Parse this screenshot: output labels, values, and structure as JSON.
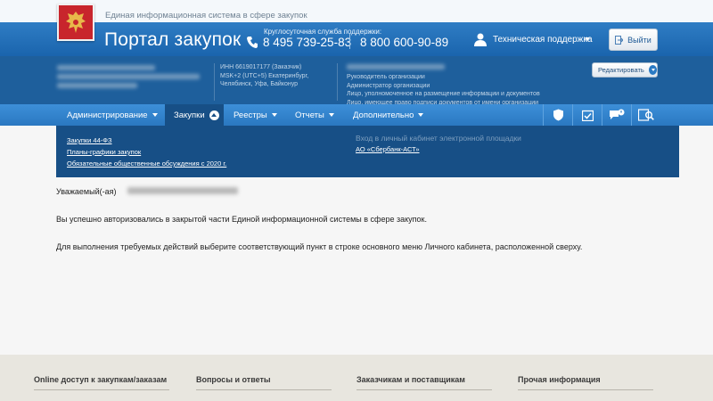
{
  "header": {
    "system_title": "Единая информационная система в сфере закупок",
    "portal_title": "Портал закупок",
    "support_caption": "Круглосуточная служба поддержки:",
    "phone_1": "8 495 739-25-83",
    "phone_2": "8 800 600-90-89",
    "tech_support": "Техническая поддержка",
    "exit_label": "Выйти"
  },
  "org": {
    "inn_line": "ИНН 6619017177 (Заказчик)",
    "tz_line1": "MSK+2 (UTC+5) Екатеринбург,",
    "tz_line2": "Челябинск, Уфа, Байконур",
    "roles": [
      "Руководитель организации",
      "Администратор организации",
      "Лицо, уполномоченное на размещение информации и документов",
      "Лицо, имеющее право подписи документов от имени организации"
    ],
    "edit_label": "Редактировать"
  },
  "nav": {
    "items": [
      {
        "label": "Администрирование"
      },
      {
        "label": "Закупки"
      },
      {
        "label": "Реестры"
      },
      {
        "label": "Отчеты"
      },
      {
        "label": "Дополнительно"
      }
    ],
    "icons": [
      "shield-icon",
      "calendar-check-icon",
      "notifications-icon",
      "search-document-icon"
    ]
  },
  "dropdown": {
    "links": [
      "Закупки 44-ФЗ",
      "Планы-графики закупок",
      "Обязательные общественные обсуждения с 2020 г."
    ],
    "platform_heading": "Вход в личный кабинет электронной площадки",
    "platform_link": "АО «Сбербанк-АСТ»"
  },
  "main": {
    "greeting": "Уважаемый(-ая)",
    "line_1": "Вы успешно авторизовались в закрытой части Единой информационной системы в сфере закупок.",
    "line_2": "Для выполнения требуемых действий выберите соответствующий пункт в строке основного меню Личного кабинета, расположенной сверху."
  },
  "footer": {
    "columns": [
      "Online доступ к закупкам/заказам",
      "Вопросы и ответы",
      "Заказчикам и поставщикам",
      "Прочая информация"
    ]
  },
  "colors": {
    "header_blue": "#2f7dc4",
    "org_panel": "#1e5f9c",
    "nav_blue": "#3d8fd8",
    "dropdown_blue": "#174f86",
    "footer_bg": "#e8e6df"
  }
}
